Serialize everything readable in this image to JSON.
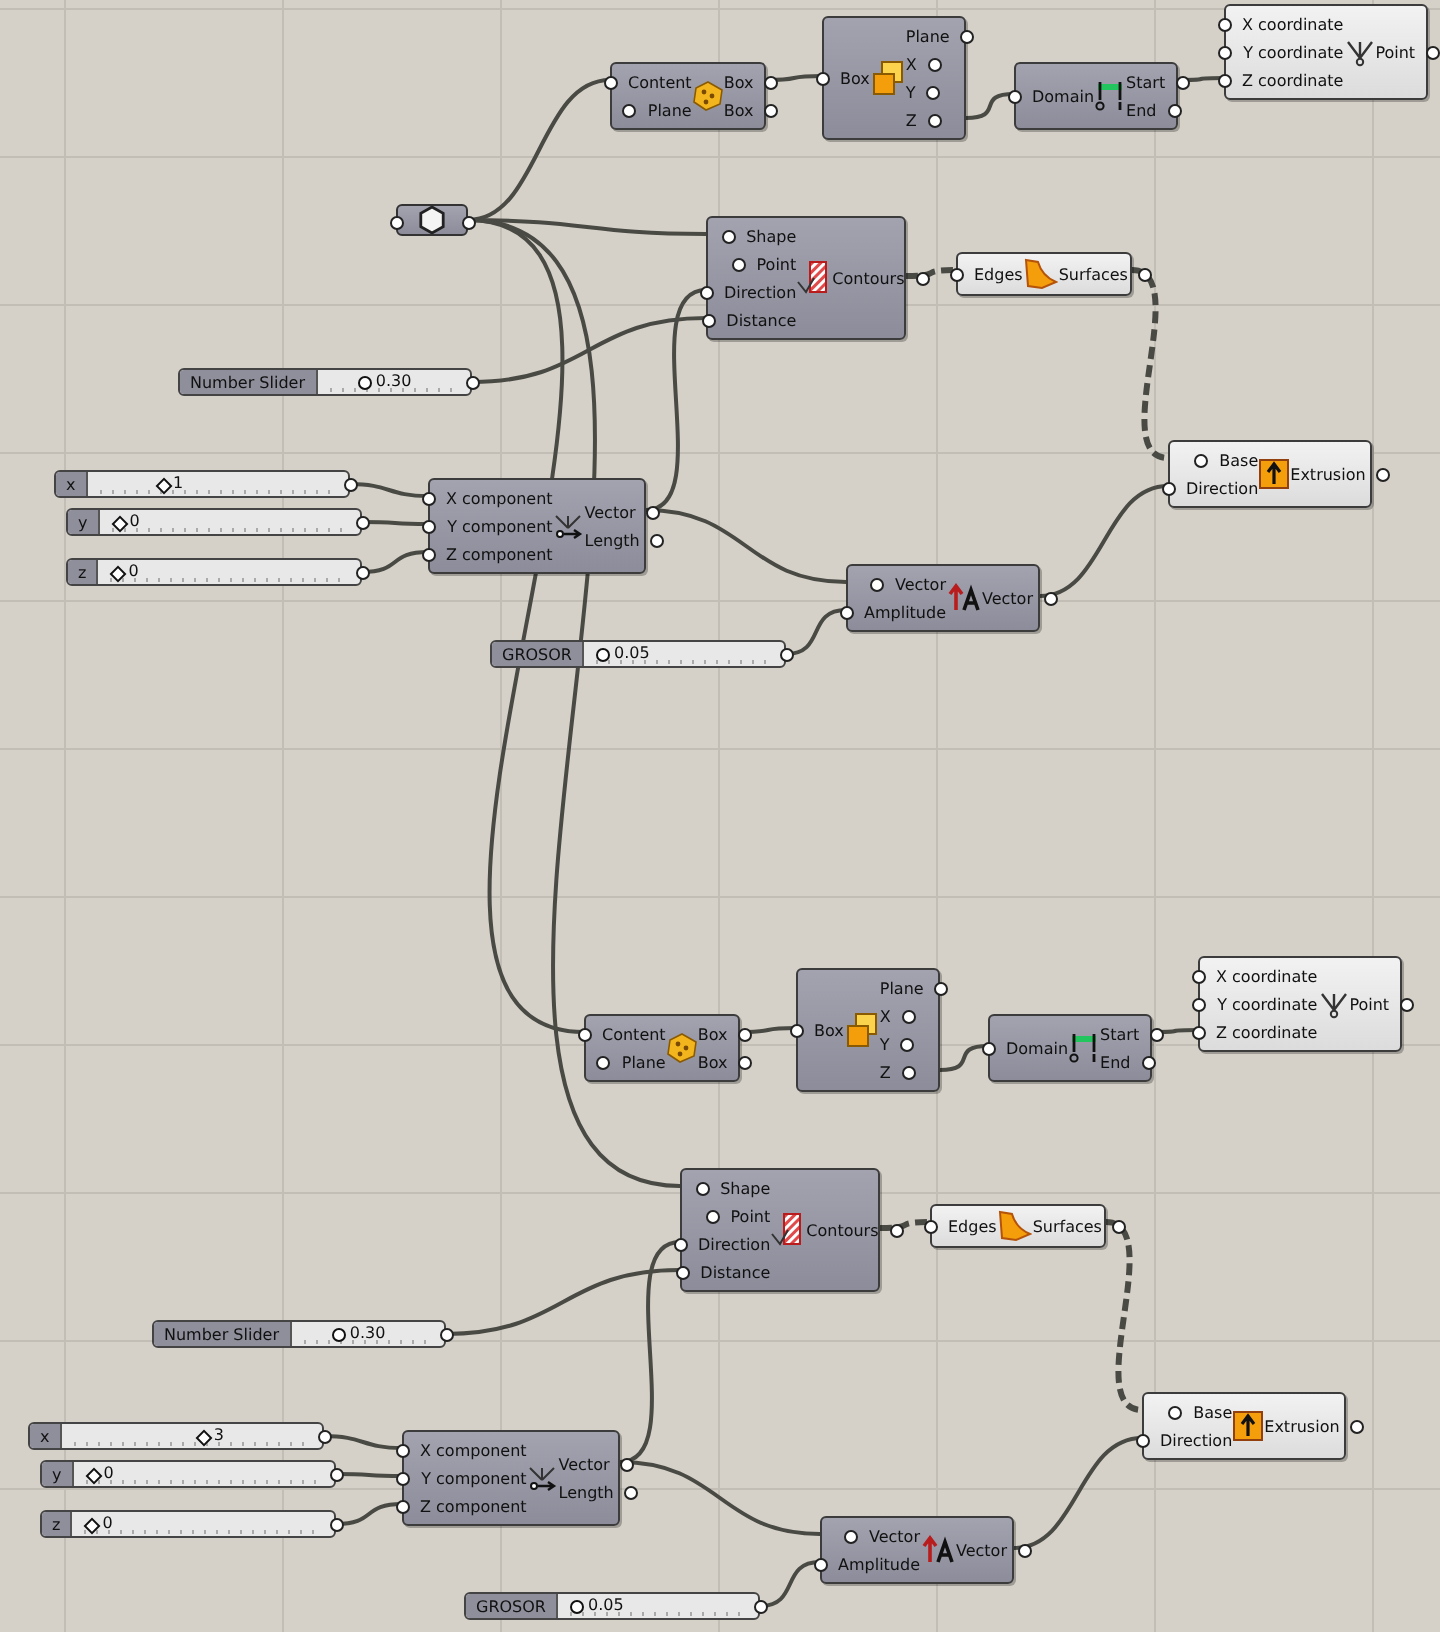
{
  "canvas": {
    "groups": [
      {
        "nodes": [
          {
            "kind": "box",
            "preview": false,
            "inputs": [
              "Content",
              "Plane"
            ],
            "outputs": [
              "Box",
              "Box"
            ]
          },
          {
            "kind": "debox",
            "preview": false,
            "inputs": [
              "Box"
            ],
            "outputs": [
              "Plane",
              "X",
              "Y",
              "Z"
            ]
          },
          {
            "kind": "domain",
            "preview": false,
            "inputs": [
              "Domain"
            ],
            "outputs": [
              "Start",
              "End"
            ]
          },
          {
            "kind": "point",
            "preview": true,
            "inputs": [
              "X coordinate",
              "Y coordinate",
              "Z coordinate"
            ],
            "outputs": [
              "Point"
            ]
          },
          {
            "kind": "geometry"
          },
          {
            "kind": "contours",
            "preview": false,
            "inputs": [
              "Shape",
              "Point",
              "Direction",
              "Distance"
            ],
            "outputs": [
              "Contours"
            ]
          },
          {
            "kind": "surfaces",
            "preview": true,
            "inputs": [
              "Edges"
            ],
            "outputs": [
              "Surfaces"
            ]
          },
          {
            "kind": "slider",
            "label": "Number Slider",
            "value": "0.30",
            "level": 0.25,
            "integer": false
          },
          {
            "kind": "slider",
            "label": "x",
            "value": "1",
            "level": 0.25,
            "integer": true
          },
          {
            "kind": "vector",
            "preview": false,
            "inputs": [
              "X component",
              "Y component",
              "Z component"
            ],
            "outputs": [
              "Vector",
              "Length"
            ]
          },
          {
            "kind": "extrude",
            "preview": true,
            "inputs": [
              "Base",
              "Direction"
            ],
            "outputs": [
              "Extrusion"
            ]
          },
          {
            "kind": "slider",
            "label": "y",
            "value": "0",
            "level": 0,
            "integer": true
          },
          {
            "kind": "slider",
            "label": "z",
            "value": "0",
            "level": 0,
            "integer": true
          },
          {
            "kind": "amplitude",
            "preview": false,
            "inputs": [
              "Vector",
              "Amplitude"
            ],
            "outputs": [
              "Vector"
            ]
          },
          {
            "kind": "slider",
            "label": "GROSOR",
            "value": "0.05",
            "level": 0,
            "integer": false
          }
        ]
      },
      {
        "nodes": [
          {
            "kind": "box",
            "preview": false,
            "inputs": [
              "Content",
              "Plane"
            ],
            "outputs": [
              "Box",
              "Box"
            ]
          },
          {
            "kind": "debox",
            "preview": false,
            "inputs": [
              "Box"
            ],
            "outputs": [
              "Plane",
              "X",
              "Y",
              "Z"
            ]
          },
          {
            "kind": "domain",
            "preview": false,
            "inputs": [
              "Domain"
            ],
            "outputs": [
              "Start",
              "End"
            ]
          },
          {
            "kind": "point",
            "preview": true,
            "inputs": [
              "X coordinate",
              "Y coordinate",
              "Z coordinate"
            ],
            "outputs": [
              "Point"
            ]
          },
          {
            "kind": "contours",
            "preview": false,
            "inputs": [
              "Shape",
              "Point",
              "Direction",
              "Distance"
            ],
            "outputs": [
              "Contours"
            ]
          },
          {
            "kind": "surfaces",
            "preview": true,
            "inputs": [
              "Edges"
            ],
            "outputs": [
              "Surfaces"
            ]
          },
          {
            "kind": "slider",
            "label": "Number Slider",
            "value": "0.30",
            "level": 0.25,
            "integer": false
          },
          {
            "kind": "slider",
            "label": "x",
            "value": "3",
            "level": 0.55,
            "integer": true
          },
          {
            "kind": "vector",
            "preview": false,
            "inputs": [
              "X component",
              "Y component",
              "Z component"
            ],
            "outputs": [
              "Vector",
              "Length"
            ]
          },
          {
            "kind": "extrude",
            "preview": true,
            "inputs": [
              "Base",
              "Direction"
            ],
            "outputs": [
              "Extrusion"
            ]
          },
          {
            "kind": "slider",
            "label": "y",
            "value": "0",
            "level": 0,
            "integer": true
          },
          {
            "kind": "slider",
            "label": "z",
            "value": "0",
            "level": 0,
            "integer": true
          },
          {
            "kind": "amplitude",
            "preview": false,
            "inputs": [
              "Vector",
              "Amplitude"
            ],
            "outputs": [
              "Vector"
            ]
          },
          {
            "kind": "slider",
            "label": "GROSOR",
            "value": "0.05",
            "level": 0,
            "integer": false
          }
        ]
      }
    ]
  }
}
